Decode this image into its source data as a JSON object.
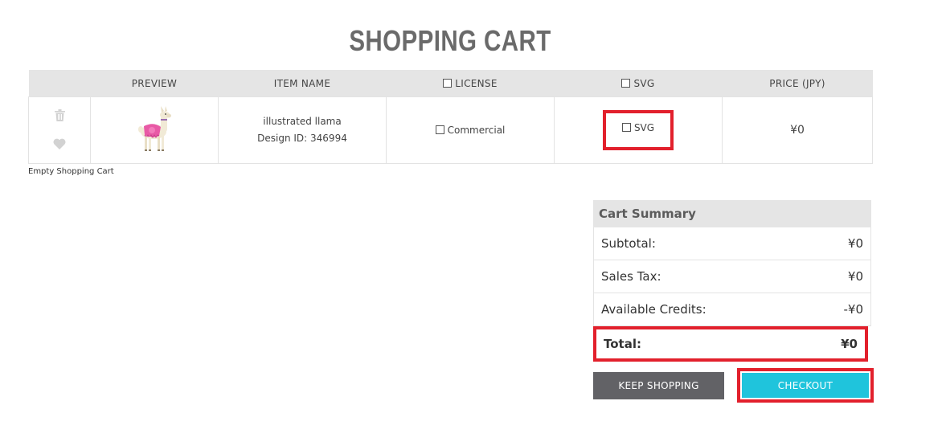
{
  "page": {
    "title": "SHOPPING CART"
  },
  "table": {
    "headers": {
      "preview": "PREVIEW",
      "item_name": "ITEM NAME",
      "license": "LICENSE",
      "svg": "SVG",
      "price": "PRICE (JPY)"
    },
    "row": {
      "item_name": "illustrated llama",
      "design_id": "Design ID: 346994",
      "license_option": "Commercial",
      "svg_option": "SVG",
      "price": "¥0"
    }
  },
  "empty_cart_label": "Empty Shopping Cart",
  "summary": {
    "title": "Cart Summary",
    "rows": [
      {
        "label": "Subtotal:",
        "value": "¥0"
      },
      {
        "label": "Sales Tax:",
        "value": "¥0"
      },
      {
        "label": "Available Credits:",
        "value": "-¥0"
      }
    ],
    "total": {
      "label": "Total:",
      "value": "¥0"
    }
  },
  "buttons": {
    "keep_shopping": "KEEP SHOPPING",
    "checkout": "CHECKOUT"
  },
  "colors": {
    "highlight": "#e2202c",
    "checkout": "#1fc4dc",
    "keep_shopping": "#626266",
    "header_bg": "#e5e5e5"
  },
  "icons": {
    "delete": "trash-icon",
    "wishlist": "heart-icon"
  }
}
